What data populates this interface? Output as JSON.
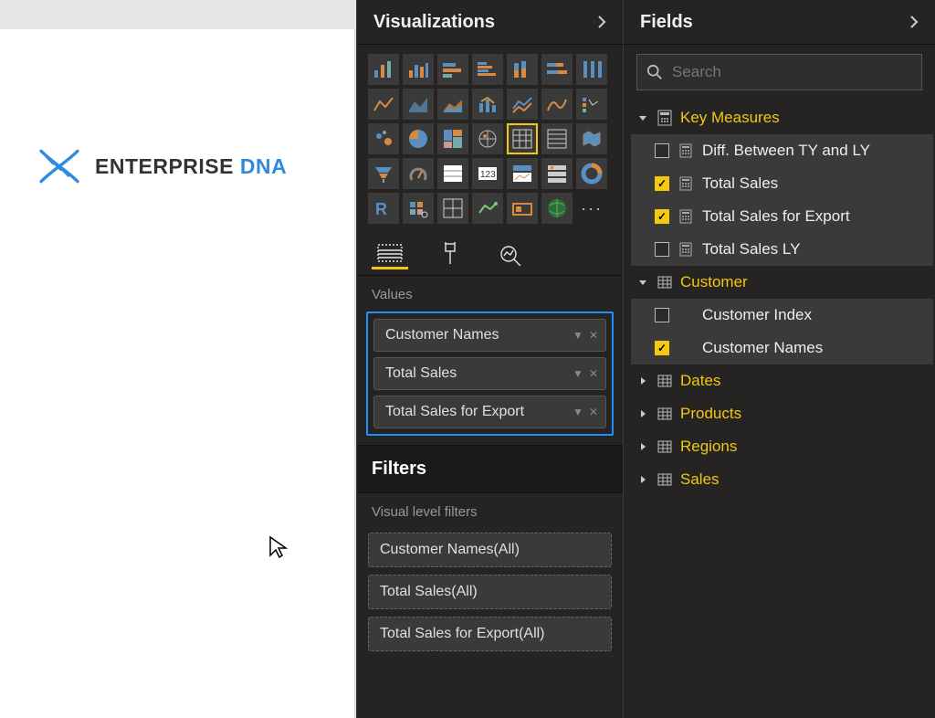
{
  "canvas": {
    "logo_main": "ENTERPRISE ",
    "logo_accent": "DNA"
  },
  "vis_panel": {
    "title": "Visualizations",
    "values_label": "Values",
    "values": [
      {
        "label": "Customer Names"
      },
      {
        "label": "Total Sales"
      },
      {
        "label": "Total Sales for Export"
      }
    ],
    "filters_title": "Filters",
    "visual_filters_label": "Visual level filters",
    "visual_filters": [
      {
        "label": "Customer Names(All)"
      },
      {
        "label": "Total Sales(All)"
      },
      {
        "label": "Total Sales for Export(All)"
      }
    ]
  },
  "fields_panel": {
    "title": "Fields",
    "search_placeholder": "Search",
    "tables": [
      {
        "name": "Key Measures",
        "expanded": true,
        "kind": "measures",
        "fields": [
          {
            "name": "Diff. Between TY and LY",
            "checked": false,
            "icon": "measure"
          },
          {
            "name": "Total Sales",
            "checked": true,
            "icon": "measure"
          },
          {
            "name": "Total Sales for Export",
            "checked": true,
            "icon": "measure"
          },
          {
            "name": "Total Sales LY",
            "checked": false,
            "icon": "measure"
          }
        ]
      },
      {
        "name": "Customer",
        "expanded": true,
        "kind": "table",
        "fields": [
          {
            "name": "Customer Index",
            "checked": false,
            "icon": "none"
          },
          {
            "name": "Customer Names",
            "checked": true,
            "icon": "none"
          }
        ]
      },
      {
        "name": "Dates",
        "expanded": false,
        "kind": "table"
      },
      {
        "name": "Products",
        "expanded": false,
        "kind": "table"
      },
      {
        "name": "Regions",
        "expanded": false,
        "kind": "table"
      },
      {
        "name": "Sales",
        "expanded": false,
        "kind": "table"
      }
    ]
  }
}
